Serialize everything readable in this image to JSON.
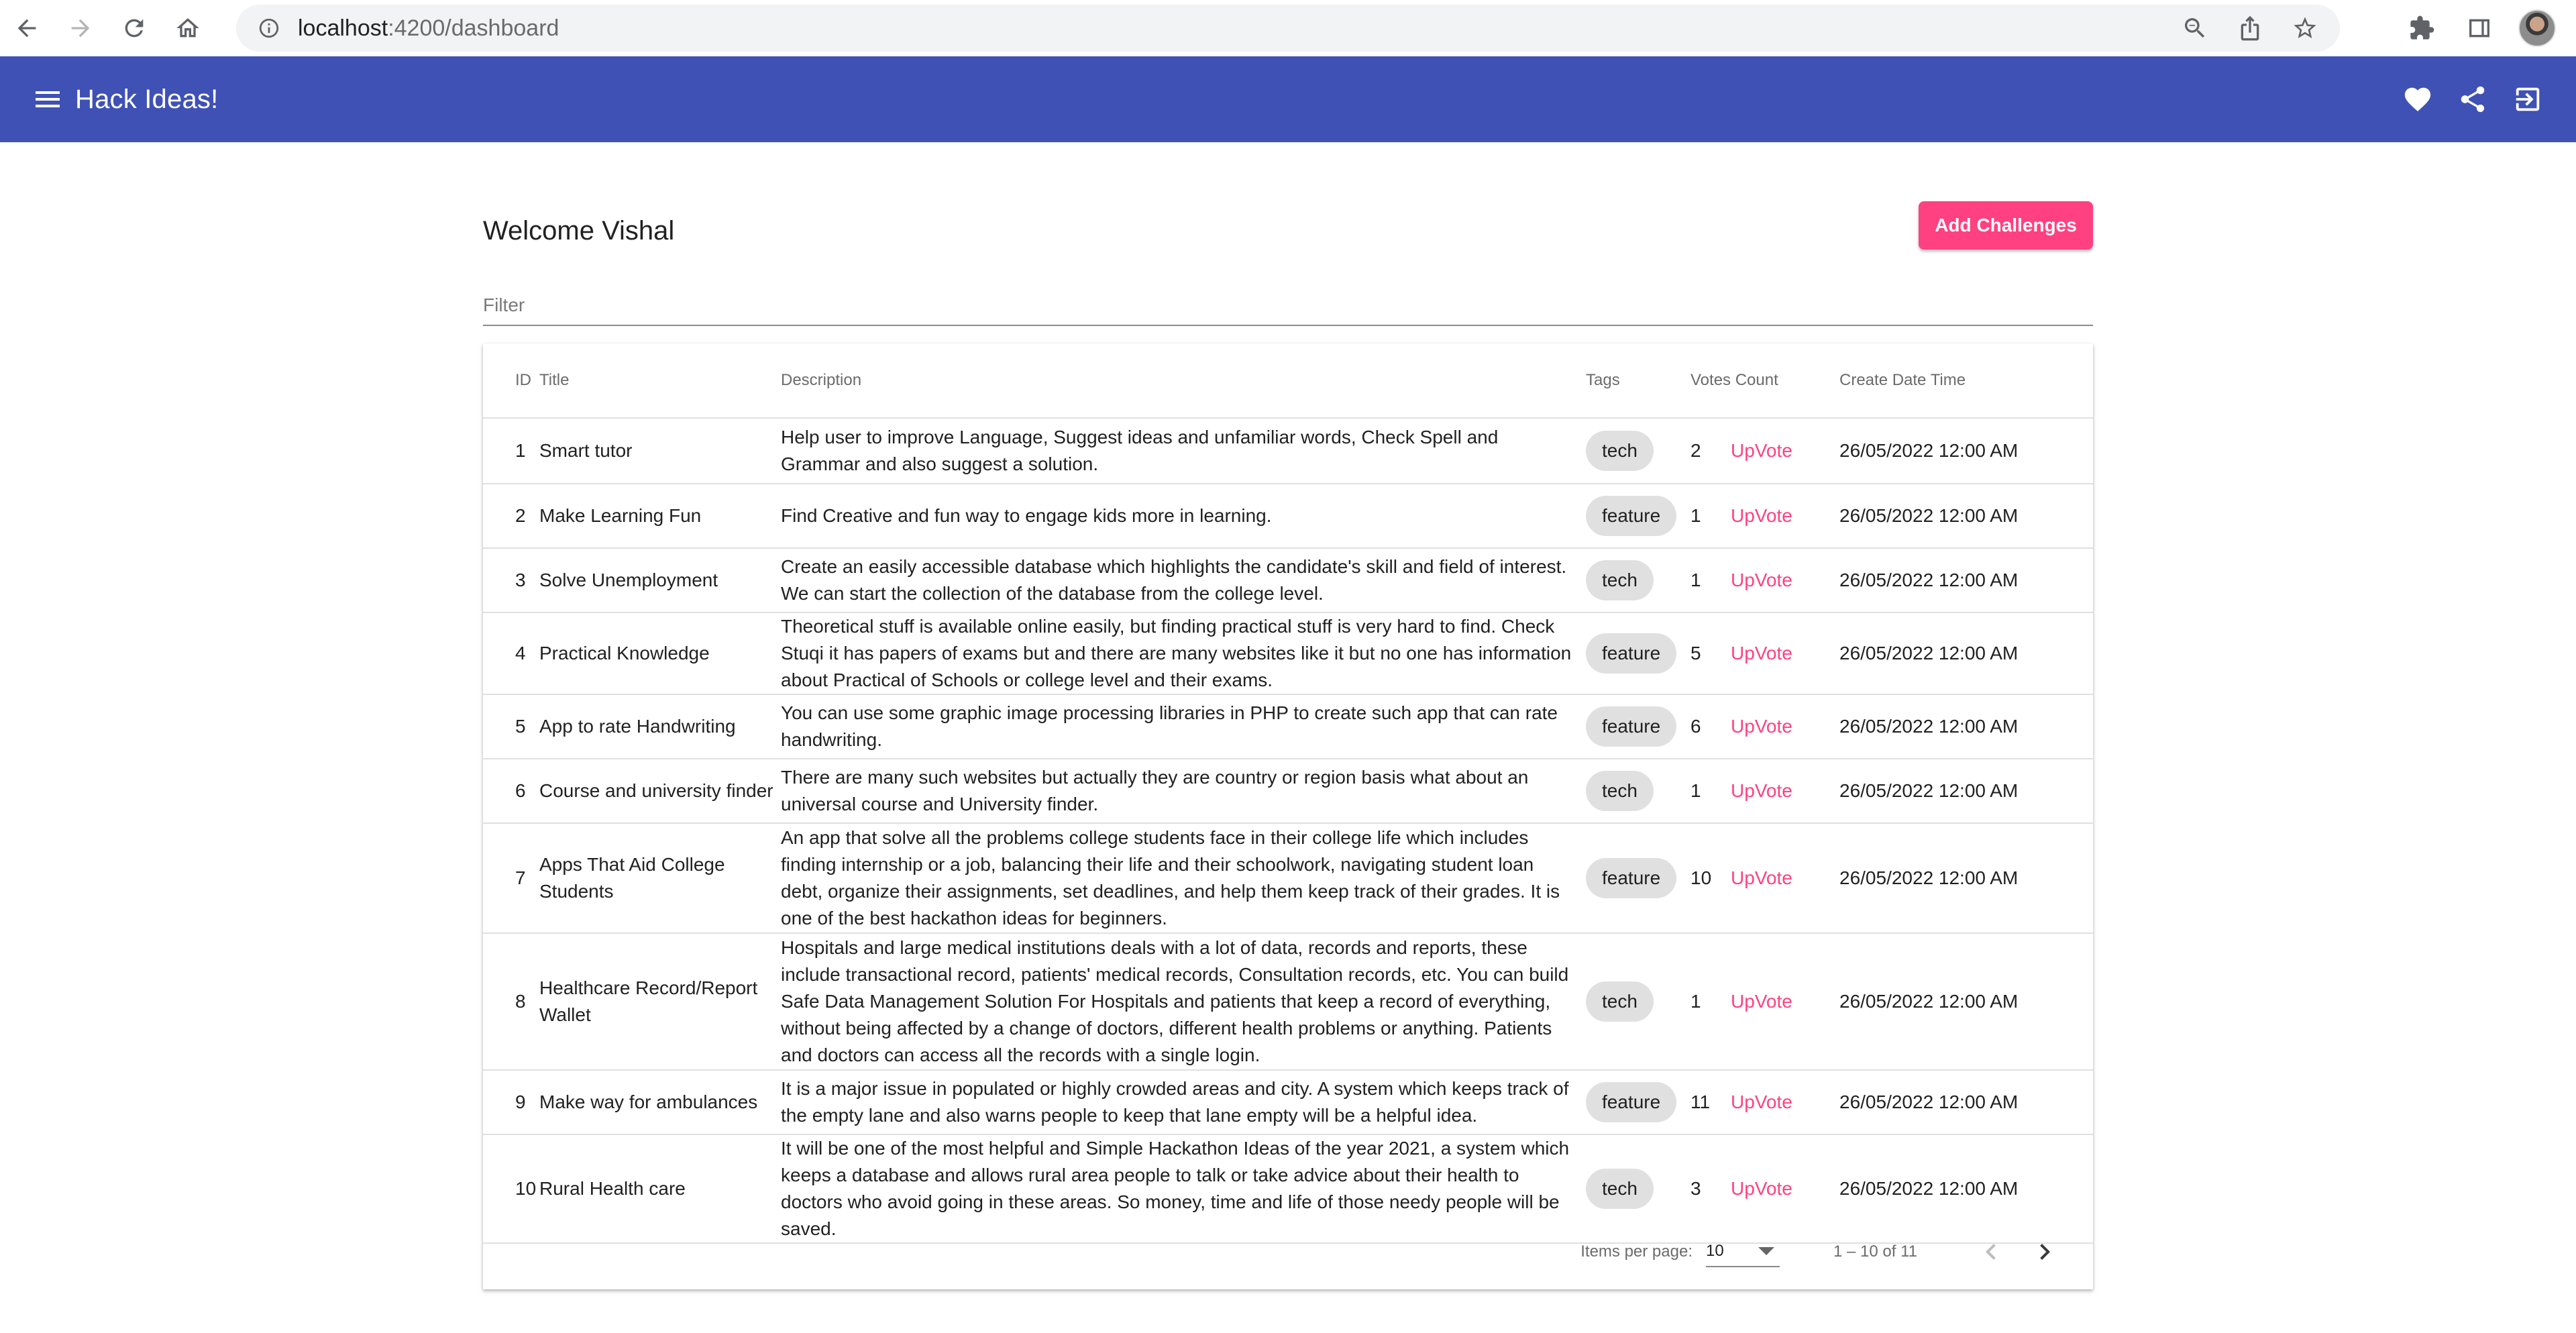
{
  "browser": {
    "url_host": "localhost",
    "url_path": ":4200/dashboard"
  },
  "app": {
    "title": "Hack Ideas!"
  },
  "page": {
    "welcome": "Welcome Vishal",
    "add_button": "Add Challenges",
    "filter_placeholder": "Filter"
  },
  "table": {
    "headers": {
      "id": "ID",
      "title": "Title",
      "description": "Description",
      "tags": "Tags",
      "votes": "Votes Count",
      "date": "Create Date Time"
    },
    "rows": [
      {
        "id": "1",
        "title": "Smart tutor",
        "description": "Help user to improve Language, Suggest ideas and unfamiliar words, Check Spell and Grammar and also suggest a solution.",
        "tag": "tech",
        "votes": "2",
        "upvote": "UpVote",
        "date": "26/05/2022 12:00 AM"
      },
      {
        "id": "2",
        "title": "Make Learning Fun",
        "description": "Find Creative and fun way to engage kids more in learning.",
        "tag": "feature",
        "votes": "1",
        "upvote": "UpVote",
        "date": "26/05/2022 12:00 AM"
      },
      {
        "id": "3",
        "title": "Solve Unemployment",
        "description": "Create an easily accessible database which highlights the candidate's skill and field of interest. We can start the collection of the database from the college level.",
        "tag": "tech",
        "votes": "1",
        "upvote": "UpVote",
        "date": "26/05/2022 12:00 AM"
      },
      {
        "id": "4",
        "title": "Practical Knowledge",
        "description": "Theoretical stuff is available online easily, but finding practical stuff is very hard to find. Check Stuqi it has papers of exams but and there are many websites like it but no one has information about Practical of Schools or college level and their exams.",
        "tag": "feature",
        "votes": "5",
        "upvote": "UpVote",
        "date": "26/05/2022 12:00 AM"
      },
      {
        "id": "5",
        "title": "App to rate Handwriting",
        "description": "You can use some graphic image processing libraries in PHP to create such app that can rate handwriting.",
        "tag": "feature",
        "votes": "6",
        "upvote": "UpVote",
        "date": "26/05/2022 12:00 AM"
      },
      {
        "id": "6",
        "title": "Course and university finder",
        "description": "There are many such websites but actually they are country or region basis what about an universal course and University finder.",
        "tag": "tech",
        "votes": "1",
        "upvote": "UpVote",
        "date": "26/05/2022 12:00 AM"
      },
      {
        "id": "7",
        "title": "Apps That Aid College Students",
        "description": "An app that solve all the problems college students face in their college life which includes finding internship or a job, balancing their life and their schoolwork, navigating student loan debt, organize their assignments, set deadlines, and help them keep track of their grades. It is one of the best hackathon ideas for beginners.",
        "tag": "feature",
        "votes": "10",
        "upvote": "UpVote",
        "date": "26/05/2022 12:00 AM"
      },
      {
        "id": "8",
        "title": "Healthcare Record/Report Wallet",
        "description": "Hospitals and large medical institutions deals with a lot of data, records and reports, these include transactional record, patients' medical records, Consultation records, etc. You can build Safe Data Management Solution For Hospitals and patients that keep a record of everything, without being affected by a change of doctors, different health problems or anything. Patients and doctors can access all the records with a single login.",
        "tag": "tech",
        "votes": "1",
        "upvote": "UpVote",
        "date": "26/05/2022 12:00 AM"
      },
      {
        "id": "9",
        "title": "Make way for ambulances",
        "description": "It is a major issue in populated or highly crowded areas and city. A system which keeps track of the empty lane and also warns people to keep that lane empty will be a helpful idea.",
        "tag": "feature",
        "votes": "11",
        "upvote": "UpVote",
        "date": "26/05/2022 12:00 AM"
      },
      {
        "id": "10",
        "title": "Rural Health care",
        "description": "It will be one of the most helpful and Simple Hackathon Ideas of the year 2021, a system which keeps a database and allows rural area people to talk or take advice about their health to doctors who avoid going in these areas. So money, time and life of those needy people will be saved.",
        "tag": "tech",
        "votes": "3",
        "upvote": "UpVote",
        "date": "26/05/2022 12:00 AM"
      }
    ]
  },
  "paginator": {
    "label": "Items per page:",
    "page_size": "10",
    "range": "1 – 10 of 11"
  },
  "colors": {
    "toolbar": "#3f51b5",
    "accent": "#ff4081"
  }
}
